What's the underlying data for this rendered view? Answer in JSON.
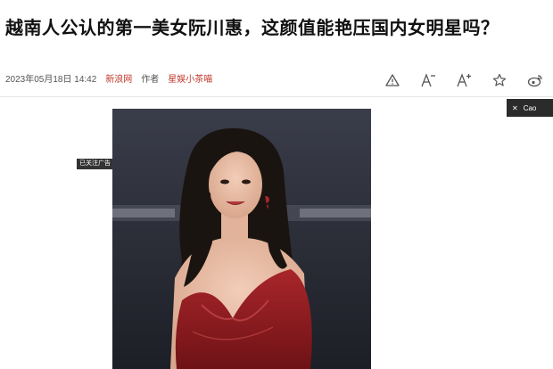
{
  "article": {
    "title": "越南人公认的第一美女阮川惠，这颜值能艳压国内女明星吗？",
    "date": "2023年05月18日 14:42",
    "source": "新浪网",
    "author_label": "作者",
    "author": "星娱小茶喵"
  },
  "toolbar": {
    "items": [
      {
        "icon": "report-warning-icon"
      },
      {
        "icon": "font-decrease-icon"
      },
      {
        "icon": "font-increase-icon"
      },
      {
        "icon": "star-favorite-icon"
      },
      {
        "icon": "weibo-share-icon"
      }
    ]
  },
  "user_chip": {
    "close": "✕",
    "name": "Cao"
  },
  "ad_label": "已关注广告",
  "colors": {
    "accent": "#c0392b",
    "dress": "#8b1a1a",
    "photo_bg": "#2c2e3a"
  }
}
